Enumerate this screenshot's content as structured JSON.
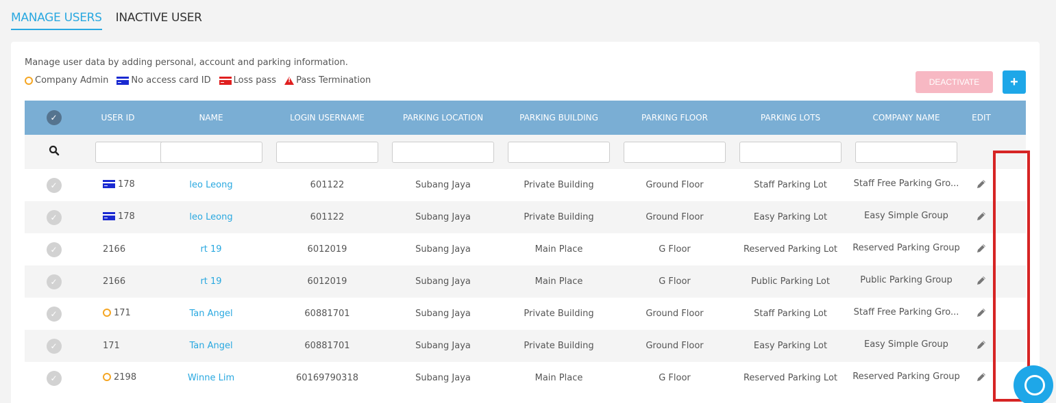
{
  "tabs": {
    "manage": "MANAGE USERS",
    "inactive": "INACTIVE USER"
  },
  "description": "Manage user data by adding personal, account and parking information.",
  "legend": {
    "company_admin": "Company Admin",
    "no_access_card": "No access card ID",
    "loss_pass": "Loss pass",
    "pass_termination": "Pass Termination"
  },
  "buttons": {
    "deactivate": "DEACTIVATE",
    "add": "+"
  },
  "columns": {
    "user_id": "USER ID",
    "name": "NAME",
    "login_username": "LOGIN USERNAME",
    "parking_location": "PARKING LOCATION",
    "parking_building": "PARKING BUILDING",
    "parking_floor": "PARKING FLOOR",
    "parking_lots": "PARKING LOTS",
    "company_name": "COMPANY NAME",
    "edit": "EDIT"
  },
  "rows": [
    {
      "marker": "card",
      "user_id": "178",
      "name": "leo Leong",
      "login": "601122",
      "location": "Subang Jaya",
      "building": "Private Building",
      "floor": "Ground Floor",
      "lots": "Staff Parking Lot",
      "company": "Staff Free Parking Gro..."
    },
    {
      "marker": "card",
      "user_id": "178",
      "name": "leo Leong",
      "login": "601122",
      "location": "Subang Jaya",
      "building": "Private Building",
      "floor": "Ground Floor",
      "lots": "Easy Parking Lot",
      "company": "Easy Simple Group"
    },
    {
      "marker": "none",
      "user_id": "2166",
      "name": "rt 19",
      "login": "6012019",
      "location": "Subang Jaya",
      "building": "Main Place",
      "floor": "G Floor",
      "lots": "Reserved Parking Lot",
      "company": "Reserved Parking Group"
    },
    {
      "marker": "none",
      "user_id": "2166",
      "name": "rt 19",
      "login": "6012019",
      "location": "Subang Jaya",
      "building": "Main Place",
      "floor": "G Floor",
      "lots": "Public Parking Lot",
      "company": "Public Parking Group"
    },
    {
      "marker": "admin",
      "user_id": "171",
      "name": "Tan Angel",
      "login": "60881701",
      "location": "Subang Jaya",
      "building": "Private Building",
      "floor": "Ground Floor",
      "lots": "Staff Parking Lot",
      "company": "Staff Free Parking Gro..."
    },
    {
      "marker": "none",
      "user_id": "171",
      "name": "Tan Angel",
      "login": "60881701",
      "location": "Subang Jaya",
      "building": "Private Building",
      "floor": "Ground Floor",
      "lots": "Easy Parking Lot",
      "company": "Easy Simple Group"
    },
    {
      "marker": "admin",
      "user_id": "2198",
      "name": "Winne Lim",
      "login": "60169790318",
      "location": "Subang Jaya",
      "building": "Main Place",
      "floor": "G Floor",
      "lots": "Reserved Parking Lot",
      "company": "Reserved Parking Group"
    }
  ],
  "colors": {
    "accent": "#29a8e0",
    "header_bg": "#7aaed4",
    "deactivate_bg": "#f7b8c3",
    "add_bg": "#1ea7e8",
    "highlight": "#d62424",
    "admin_marker": "#f5a623",
    "card_marker": "#1a2ad1"
  },
  "icons": {
    "search": "magnifier",
    "edit": "pencil",
    "select": "check-circle",
    "chat": "chat-bubble"
  }
}
